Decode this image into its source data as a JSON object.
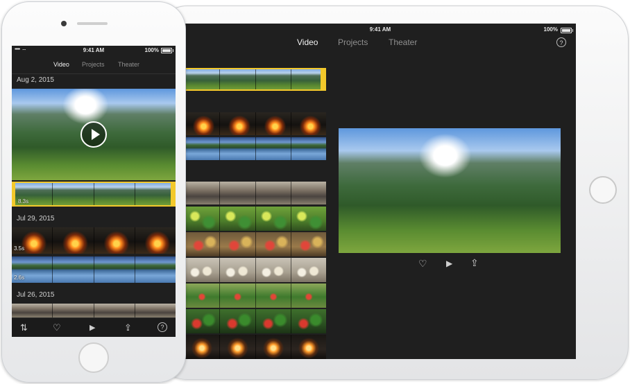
{
  "ipad": {
    "status": {
      "time": "9:41 AM",
      "battery": "100%"
    },
    "tabs": [
      {
        "label": "Video",
        "active": true
      },
      {
        "label": "Projects",
        "active": false
      },
      {
        "label": "Theater",
        "active": false
      }
    ],
    "help_label": "?",
    "preview_controls": {
      "favorite": "♡",
      "play": "▶",
      "share": "⇪"
    }
  },
  "iphone": {
    "status": {
      "time": "9:41 AM",
      "battery": "100%",
      "signal": "•••••"
    },
    "tabs": [
      {
        "label": "Video",
        "active": true
      },
      {
        "label": "Projects",
        "active": false
      },
      {
        "label": "Theater",
        "active": false
      }
    ],
    "sections": [
      {
        "date": "Aug 2, 2015",
        "clips": [
          {
            "duration": "8.3s"
          }
        ]
      },
      {
        "date": "Jul 29, 2015",
        "clips": [
          {
            "duration": "3.5s"
          },
          {
            "duration": "2.6s"
          }
        ]
      },
      {
        "date": "Jul 26, 2015",
        "clips": []
      }
    ],
    "toolbar": {
      "sort": "⇅",
      "favorite": "♡",
      "play": "▶",
      "share": "⇪",
      "help": "?"
    }
  },
  "colors": {
    "accent": "#f3c92b",
    "background": "#1f1f1f"
  }
}
